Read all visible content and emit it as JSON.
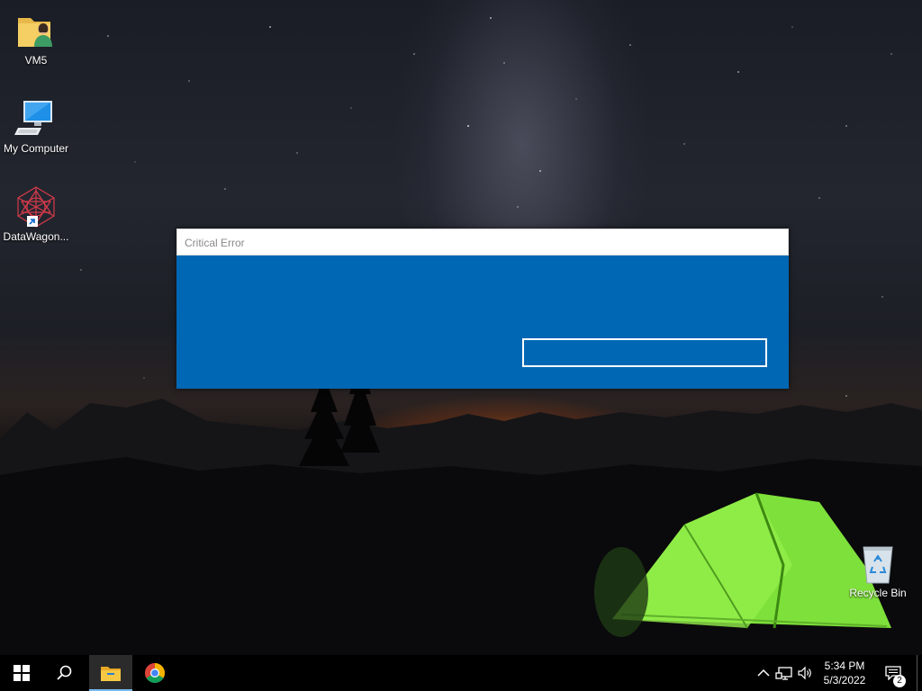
{
  "desktop": {
    "icons": [
      {
        "label": "VM5",
        "icon": "user-folder-icon"
      },
      {
        "label": "My Computer",
        "icon": "computer-icon"
      },
      {
        "label": "DataWagon...",
        "icon": "datawagon-shortcut-icon"
      },
      {
        "label": "Recycle Bin",
        "icon": "recycle-bin-icon"
      }
    ]
  },
  "dialog": {
    "title": "Critical Error",
    "button_label": "",
    "colors": {
      "body": "#0067b4",
      "title_bar": "#ffffff",
      "title_text": "#8a8a8a"
    }
  },
  "taskbar": {
    "start_icon": "windows-logo-icon",
    "search_icon": "search-icon",
    "pinned": [
      {
        "name": "File Explorer",
        "icon": "file-explorer-icon",
        "active": true
      },
      {
        "name": "Google Chrome",
        "icon": "chrome-icon",
        "active": false
      }
    ],
    "tray": {
      "icons": [
        "chevron-up-icon",
        "network-icon",
        "volume-icon"
      ],
      "time": "5:34 PM",
      "date": "5/3/2022",
      "notification_count": "2"
    }
  }
}
